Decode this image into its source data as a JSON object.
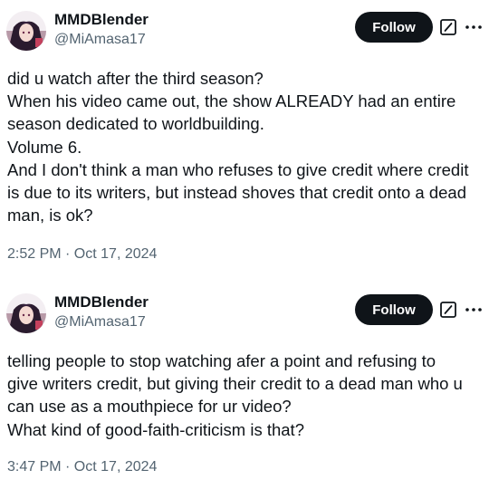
{
  "tweets": [
    {
      "author": {
        "display_name": "MMDBlender",
        "handle": "@MiAmasa17"
      },
      "follow_label": "Follow",
      "icons": {
        "grok": "grok-edit-icon",
        "more": "more-dots-icon"
      },
      "text_lines": [
        "did u watch after the third season?",
        "When his video came out, the show ALREADY had an entire",
        "season dedicated to worldbuilding.",
        "Volume 6.",
        "And I don't think a man who refuses to give credit where credit",
        "is due to its writers, but instead shoves that credit onto a dead",
        "man, is ok?"
      ],
      "timestamp": "2:52 PM · Oct 17, 2024"
    },
    {
      "author": {
        "display_name": "MMDBlender",
        "handle": "@MiAmasa17"
      },
      "follow_label": "Follow",
      "icons": {
        "grok": "grok-edit-icon",
        "more": "more-dots-icon"
      },
      "text_lines": [
        "telling people to stop watching afer a point and refusing to",
        "give writers credit, but giving their credit to a  dead man who u",
        "can use as a  mouthpiece for ur video?",
        "What kind of good-faith-criticism is that?"
      ],
      "timestamp": "3:47 PM · Oct 17, 2024"
    }
  ],
  "colors": {
    "text_primary": "#0f1419",
    "text_secondary": "#536471",
    "follow_bg": "#0f1419",
    "follow_text": "#ffffff"
  }
}
